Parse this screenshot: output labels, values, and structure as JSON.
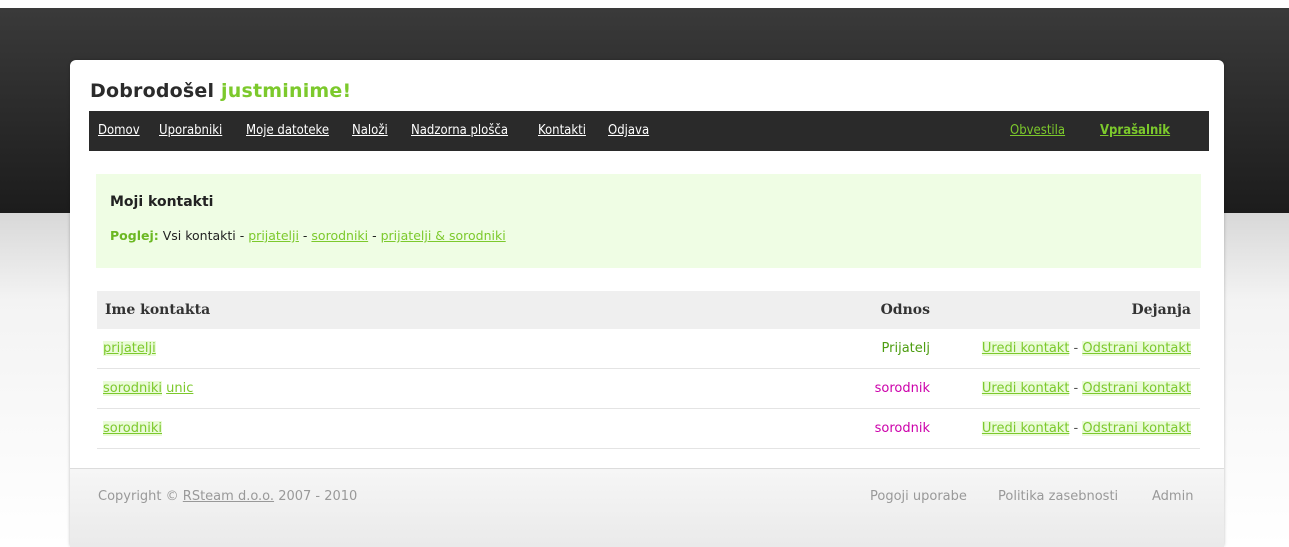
{
  "header": {
    "welcome_prefix": "Dobrodošel",
    "username": "justminime!"
  },
  "nav": {
    "items": [
      "Domov",
      "Uporabniki",
      "Moje datoteke",
      "Naloži",
      "Nadzorna plošča",
      "Kontakti",
      "Odjava"
    ],
    "right": [
      "Obvestila",
      "Vprašalnik"
    ]
  },
  "section": {
    "title": "Moji kontakti",
    "view_label": "Poglej:",
    "view_current": "Vsi kontakti",
    "separator": " - ",
    "view_links": [
      "prijatelji",
      "sorodniki",
      "prijatelji & sorodniki"
    ]
  },
  "table": {
    "headers": [
      "Ime kontakta",
      "Odnos",
      "Dejanja"
    ],
    "rows": [
      {
        "name": "prijatelji",
        "name_extra": "",
        "relation": "Prijatelj"
      },
      {
        "name": "sorodniki",
        "name_extra": "unic",
        "relation": "sorodnik"
      },
      {
        "name": "sorodniki",
        "name_extra": "",
        "relation": "sorodnik"
      }
    ],
    "action_edit": "Uredi kontakt",
    "action_remove": "Odstrani kontakt"
  },
  "footer": {
    "copyright_prefix": "Copyright ©",
    "company": "RSteam d.o.o.",
    "years": "2007 - 2010",
    "links": [
      "Pogoji uporabe",
      "Politika zasebnosti",
      "Admin"
    ]
  },
  "colors": {
    "accent_green": "#7cc92c",
    "relative_magenta": "#cc00aa",
    "nav_bg": "#2a2a2a"
  }
}
